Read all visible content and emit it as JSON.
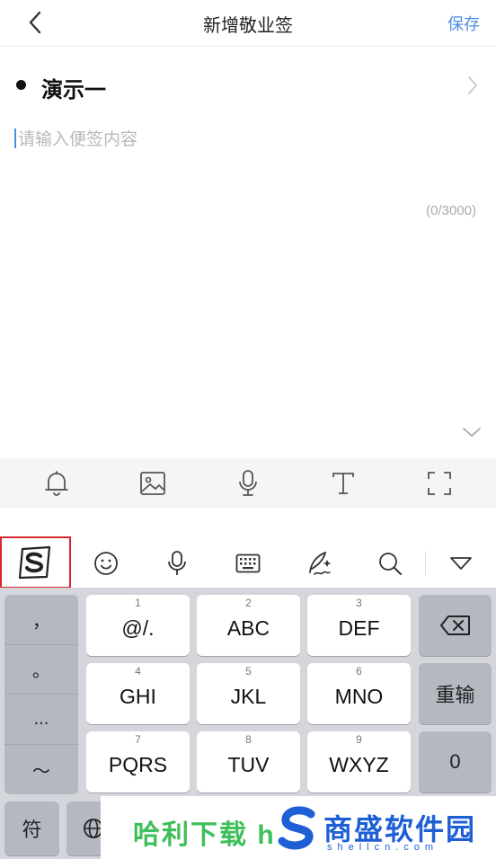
{
  "header": {
    "title": "新增敬业签",
    "save_label": "保存"
  },
  "note": {
    "title": "演示一",
    "placeholder": "请输入便签内容",
    "counter": "(0/3000)"
  },
  "toolbar": {
    "icons": [
      "bell-icon",
      "image-icon",
      "microphone-icon",
      "text-format-icon",
      "fullscreen-icon"
    ]
  },
  "ime_bar": {
    "icons": [
      "sogou-logo-icon",
      "emoji-icon",
      "voice-icon",
      "keyboard-icon",
      "handwriting-icon",
      "search-icon",
      "collapse-icon"
    ]
  },
  "keyboard": {
    "punctuation": [
      "，",
      "。",
      "...",
      "～"
    ],
    "keys": [
      {
        "num": "1",
        "label": "@/."
      },
      {
        "num": "2",
        "label": "ABC"
      },
      {
        "num": "3",
        "label": "DEF"
      },
      {
        "num": "4",
        "label": "GHI"
      },
      {
        "num": "5",
        "label": "JKL"
      },
      {
        "num": "6",
        "label": "MNO"
      },
      {
        "num": "7",
        "label": "PQRS"
      },
      {
        "num": "8",
        "label": "TUV"
      },
      {
        "num": "9",
        "label": "WXYZ"
      }
    ],
    "reinput_label": "重输",
    "zero_label": "0",
    "symbol_label": "符"
  },
  "watermark": {
    "text_left": "哈利下载 h",
    "text_right": "商盛软件园",
    "domain": "shellcn.com"
  },
  "colors": {
    "accent": "#4a90e2",
    "highlight_border": "#d9272e",
    "watermark_green": "#3fbf5a",
    "watermark_blue": "#1e5fd6"
  }
}
